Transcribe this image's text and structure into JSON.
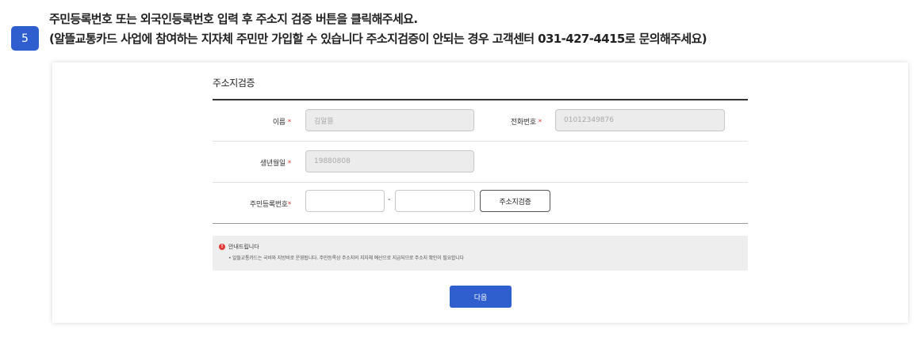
{
  "step": {
    "number": "5"
  },
  "instructions": {
    "line1": "주민등록번호 또는 외국인등록번호 입력 후 주소지 검증 버튼을 클릭해주세요.",
    "line2": "(알뜰교통카드 사업에 참여하는 지자체 주민만 가입할 수 있습니다 주소지검증이 안되는 경우 고객센터 031-427-4415로 문의해주세요)"
  },
  "form": {
    "title": "주소지검증",
    "name": {
      "label": "이름",
      "required_mark": "*",
      "value": "김알뜰"
    },
    "phone": {
      "label": "전화번호",
      "required_mark": "*",
      "value": "01012349876"
    },
    "birth": {
      "label": "생년월일",
      "required_mark": "*",
      "value": "19880808"
    },
    "rrn": {
      "label": "주민등록번호",
      "required_mark": "*",
      "first_value": "",
      "separator": "-",
      "second_value": "",
      "verify_label": "주소지검증"
    }
  },
  "notice": {
    "title": "안내드립니다",
    "text": "• 알뜰교통카드는 국비와 지방비로 운영됩니다. 주민등록상 주소지의 지자체 예산으로 지급되므로 주소지 확인이 필요합니다"
  },
  "actions": {
    "next_label": "다음"
  },
  "colors": {
    "accent": "#2f5fce",
    "required": "#e03a3a",
    "disabled_field": "#ececec"
  }
}
